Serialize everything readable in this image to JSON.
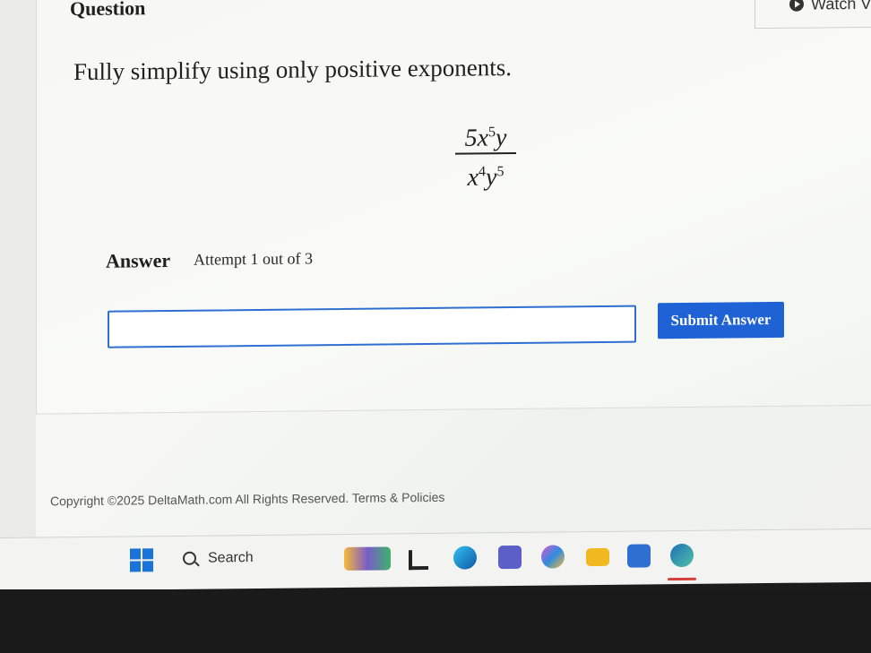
{
  "question": {
    "heading": "Question",
    "watch_label": "Watch V",
    "instruction": "Fully simplify using only positive exponents.",
    "expression": {
      "numerator": {
        "coef": "5",
        "x": "x",
        "x_exp": "5",
        "y": "y"
      },
      "denominator": {
        "x": "x",
        "x_exp": "4",
        "y": "y",
        "y_exp": "5"
      }
    }
  },
  "answer": {
    "label": "Answer",
    "attempt": "Attempt 1 out of 3",
    "input_value": "",
    "submit_label": "Submit Answer"
  },
  "footer": {
    "copyright": "Copyright ©2025 DeltaMath.com All Rights Reserved. Terms & Policies"
  },
  "taskbar": {
    "search_label": "Search",
    "icons": [
      {
        "name": "windows-start-icon",
        "color": "#1a73d9"
      },
      {
        "name": "widgets-icon",
        "color": "#7b5cc9"
      },
      {
        "name": "task-view-icon",
        "color": "#222222"
      },
      {
        "name": "edge-icon",
        "color": "#0c8bd8"
      },
      {
        "name": "teams-icon",
        "color": "#5b5fc7"
      },
      {
        "name": "copilot-icon",
        "color": "#e05ad1"
      },
      {
        "name": "file-explorer-icon",
        "color": "#f2b81f"
      },
      {
        "name": "store-icon",
        "color": "#2f6fd1"
      },
      {
        "name": "browser-icon",
        "color": "#1f6fb4"
      }
    ]
  }
}
